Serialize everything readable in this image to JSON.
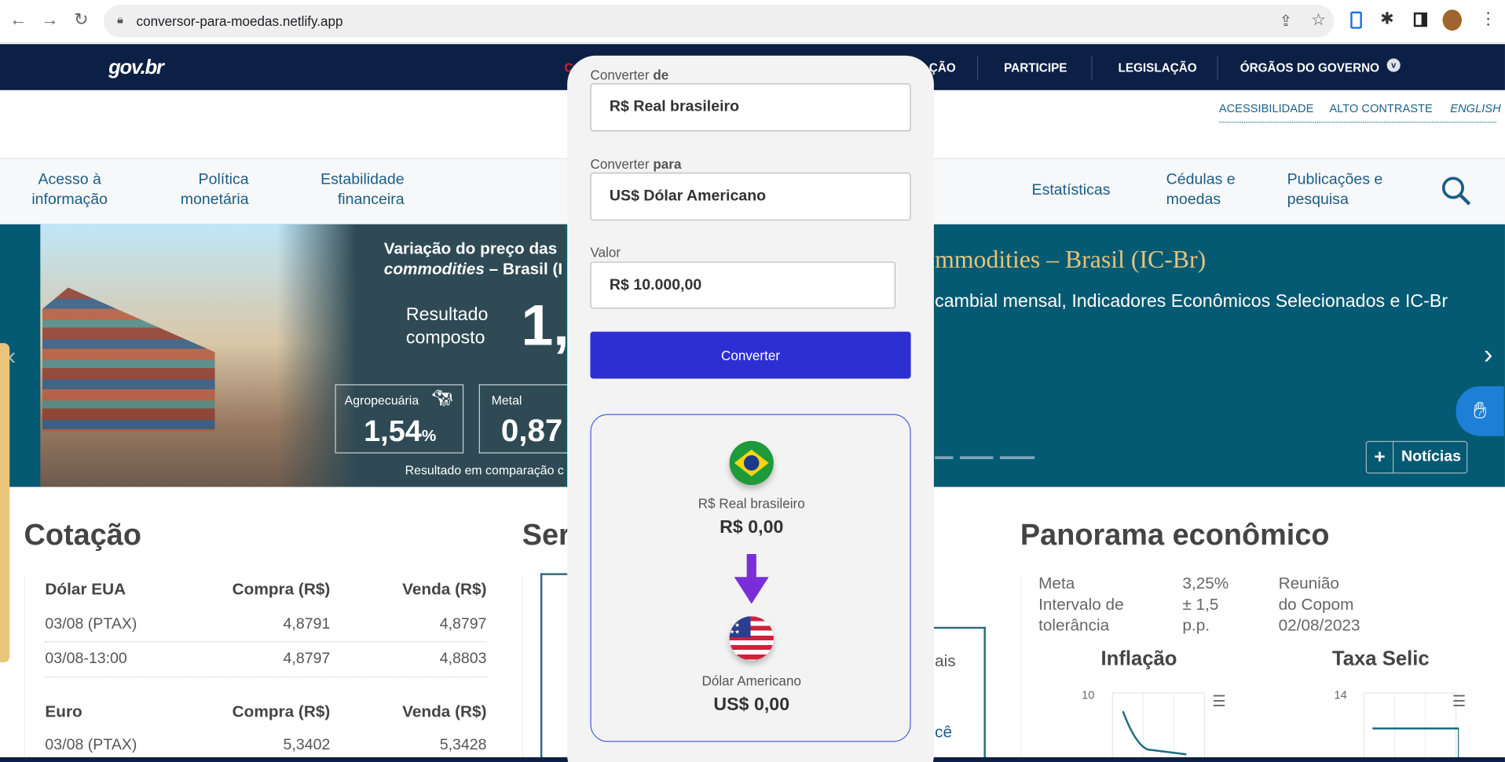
{
  "browser": {
    "url": "conversor-para-moedas.netlify.app",
    "back_icon": "arrow-left",
    "forward_icon": "arrow-right",
    "reload_icon": "reload"
  },
  "header": {
    "logo": "gov.br",
    "nav_partial_left": "C",
    "nav_partial": "ÇÃO",
    "nav": [
      "PARTICIPE",
      "LEGISLAÇÃO",
      "ÓRGÃOS DO GOVERNO"
    ]
  },
  "accessibility": [
    "ACESSIBILIDADE",
    "ALTO CONTRASTE",
    "ENGLISH"
  ],
  "menu": {
    "left": [
      [
        "Acesso à",
        "informação"
      ],
      [
        "Política",
        "monetária"
      ],
      [
        "Estabilidade",
        "financeira"
      ]
    ],
    "right": [
      [
        "Estatísticas",
        ""
      ],
      [
        "Cédulas e",
        "moedas"
      ],
      [
        "Publicações e",
        "pesquisa"
      ]
    ]
  },
  "banner": {
    "title_1": "Variação do preço das",
    "title_2a": "commodities",
    "title_2b": " – Brasil (I",
    "result_label_1": "Resultado",
    "result_label_2": "composto",
    "result_value": "1,",
    "boxes": [
      {
        "label": "Agropecuária",
        "value": "1,54",
        "unit": "%"
      },
      {
        "label": "Metal",
        "value": "0,87"
      }
    ],
    "footnote": "Resultado em comparação c",
    "right_title": "mmodities – Brasil (IC-Br)",
    "right_sub": "cambial mensal, Indicadores Econômicos Selecionados e IC-Br",
    "news_button": "Notícias"
  },
  "cotacao": {
    "title": "Cotação",
    "tables": [
      {
        "currency": "Dólar EUA",
        "buy_header": "Compra (R$)",
        "sell_header": "Venda (R$)",
        "rows": [
          [
            "03/08 (PTAX)",
            "4,8791",
            "4,8797"
          ],
          [
            "03/08-13:00",
            "4,8797",
            "4,8803"
          ]
        ]
      },
      {
        "currency": "Euro",
        "buy_header": "Compra (R$)",
        "sell_header": "Venda (R$)",
        "rows": [
          [
            "03/08 (PTAX)",
            "5,3402",
            "5,3428"
          ]
        ]
      }
    ]
  },
  "middle": {
    "title_partial": "Ser",
    "partial_1": "ais",
    "partial_2": "cê"
  },
  "panorama": {
    "title": "Panorama econômico",
    "meta_label": "Meta",
    "meta_value": "3,25%",
    "interval_label_1": "Intervalo de",
    "interval_label_2": "tolerância",
    "interval_value_1": "± 1,5",
    "interval_value_2": "p.p.",
    "copom_1": "Reunião",
    "copom_2": "do Copom",
    "copom_3": "02/08/2023",
    "charts": [
      {
        "title": "Inflação",
        "y_top": "10"
      },
      {
        "title": "Taxa Selic",
        "y_top": "14"
      }
    ]
  },
  "converter": {
    "from_label_a": "Converter ",
    "from_label_b": "de",
    "from_value": "R$ Real brasileiro",
    "to_label_a": "Converter ",
    "to_label_b": "para",
    "to_value": "US$ Dólar Americano",
    "amount_label": "Valor",
    "amount_value": "R$ 10.000,00",
    "button": "Converter",
    "from_name": "R$ Real brasileiro",
    "from_result": "R$ 0,00",
    "to_name": "Dólar Americano",
    "to_result": "US$ 0,00",
    "button_color": "#2e2fd3",
    "arrow_color": "#7a2fd6"
  }
}
